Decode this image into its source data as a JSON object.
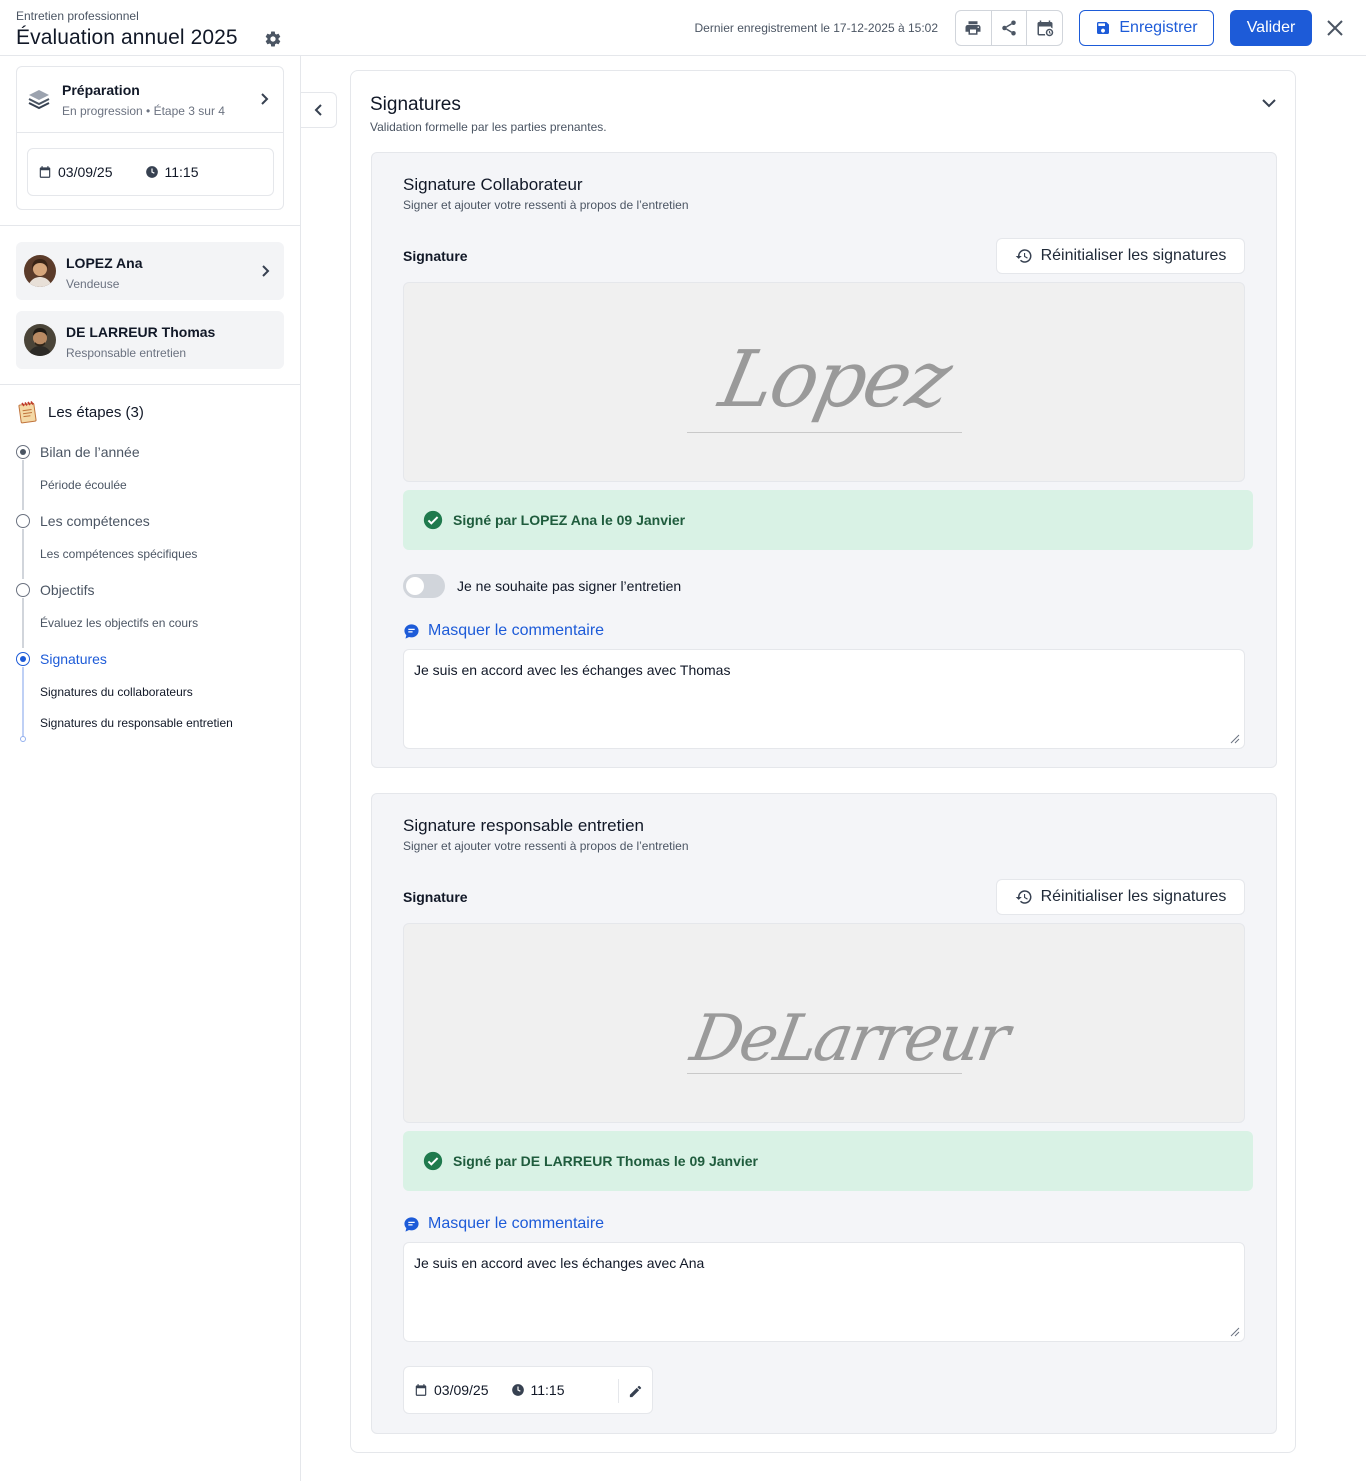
{
  "header": {
    "subtitle": "Entretien professionnel",
    "title": "Évaluation annuel 2025",
    "last_saved": "Dernier enregistrement le 17-12-2025 à 15:02",
    "save_label": "Enregistrer",
    "validate_label": "Valider"
  },
  "sidebar": {
    "preparation": {
      "title": "Préparation",
      "status": "En progression • Étape 3 sur 4",
      "date": "03/09/25",
      "time": "11:15"
    },
    "people": [
      {
        "name": "LOPEZ Ana",
        "role": "Vendeuse"
      },
      {
        "name": "DE LARREUR Thomas",
        "role": "Responsable entretien"
      }
    ],
    "steps_title": "Les étapes (3)",
    "steps": [
      {
        "label": "Bilan de l’année",
        "sub": [
          "Période écoulée"
        ]
      },
      {
        "label": "Les compétences",
        "sub": [
          "Les compétences spécifiques"
        ]
      },
      {
        "label": "Objectifs",
        "sub": [
          "Évaluez les objectifs en cours"
        ]
      },
      {
        "label": "Signatures",
        "sub": [
          "Signatures du collaborateurs",
          "Signatures du responsable entretien"
        ]
      }
    ]
  },
  "main": {
    "title": "Signatures",
    "subtitle": "Validation formelle par les parties prenantes.",
    "collaborator": {
      "title": "Signature Collaborateur",
      "subtitle": "Signer et ajouter votre ressenti à propos de l’entretien",
      "signature_label": "Signature",
      "reset_label": "Réinitialiser les signatures",
      "signature_text": "Lopez",
      "signed_text": "Signé par LOPEZ Ana le 09 Janvier",
      "decline_label": "Je ne souhaite pas signer l’entretien",
      "comment_toggle": "Masquer le commentaire",
      "comment": "Je suis en accord avec les échanges avec Thomas"
    },
    "manager": {
      "title": "Signature responsable entretien",
      "subtitle": "Signer et ajouter votre ressenti à propos de l’entretien",
      "signature_label": "Signature",
      "reset_label": "Réinitialiser les signatures",
      "signature_text": "DeLarreur",
      "signed_text": "Signé par DE LARREUR Thomas le 09 Janvier",
      "comment_toggle": "Masquer le commentaire",
      "comment": "Je suis en accord avec les échanges avec Ana",
      "date": "03/09/25",
      "time": "11:15"
    }
  },
  "colors": {
    "accent": "#1d5bd8",
    "success_bg": "#d9f2e5",
    "success_icon": "#1f7a4d"
  }
}
